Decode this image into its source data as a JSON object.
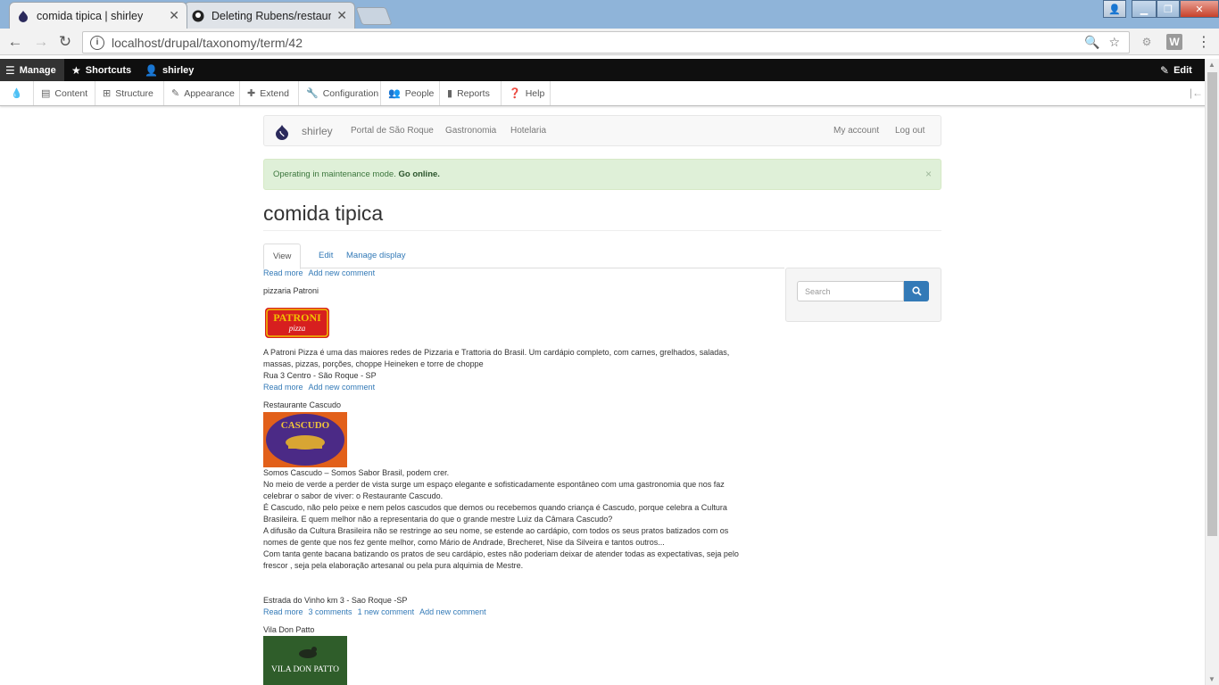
{
  "browser": {
    "tabs": [
      {
        "title": "comida tipica | shirley",
        "icon": "drupal-icon",
        "active": true
      },
      {
        "title": "Deleting Rubens/restaurante",
        "icon": "github-icon",
        "active": false
      }
    ],
    "url": "localhost/drupal/taxonomy/term/42",
    "ext_w": "W"
  },
  "admin_toolbar": {
    "manage": "Manage",
    "shortcuts": "Shortcuts",
    "user": "shirley",
    "edit": "Edit",
    "tray": [
      "Content",
      "Structure",
      "Appearance",
      "Extend",
      "Configuration",
      "People",
      "Reports",
      "Help"
    ]
  },
  "site_nav": {
    "brand": "shirley",
    "links": [
      "Portal de São Roque",
      "Gastronomia",
      "Hotelaria"
    ],
    "account": "My account",
    "logout": "Log out"
  },
  "alert": {
    "message": "Operating in maintenance mode.",
    "link": "Go online.",
    "close": "×"
  },
  "page": {
    "title": "comida tipica",
    "tabs": [
      "View",
      "Edit",
      "Manage display"
    ]
  },
  "search": {
    "placeholder": "Search"
  },
  "content": {
    "top_links": [
      "Read more",
      "Add new comment"
    ],
    "items": [
      {
        "title": "pizzaria Patroni",
        "logo_text": "PATRONI",
        "logo_sub": "pizza",
        "body": [
          "A Patroni Pizza é uma das maiores redes de Pizzaria e Trattoria do Brasil. Um cardápio completo, com carnes, grelhados, saladas,",
          "massas, pizzas, porções, choppe Heineken e torre de choppe",
          "Rua 3 Centro - São Roque - SP"
        ],
        "links": [
          "Read more",
          "Add new comment"
        ]
      },
      {
        "title": "Restaurante Cascudo",
        "logo_text": "CASCUDO",
        "body": [
          "Somos Cascudo – Somos Sabor Brasil, podem crer.",
          "No meio de verde a perder de vista surge um espaço elegante e sofisticadamente espontâneo com uma gastronomia que nos faz",
          "celebrar o sabor de viver: o Restaurante Cascudo.",
          "É Cascudo, não pelo peixe e nem pelos cascudos que demos ou recebemos quando criança é Cascudo, porque celebra a Cultura",
          "Brasileira. E quem melhor não a representaria do que o grande mestre Luiz da Câmara Cascudo?",
          "A difusão da Cultura Brasileira não se restringe ao seu nome, se estende ao cardápio, com todos os seus pratos batizados com os",
          "nomes de gente que nos fez gente melhor, como Mário de Andrade, Brecheret, Nise da Silveira e tantos outros...",
          "Com tanta gente bacana batizando os pratos de seu cardápio, estes não poderiam deixar de atender todas as expectativas, seja pelo",
          "frescor , seja pela elaboração artesanal ou pela pura alquimia de Mestre.",
          "",
          "",
          "Estrada do Vinho km 3 - Sao Roque -SP"
        ],
        "links": [
          "Read more",
          "3 comments",
          "1 new comment",
          "Add new comment"
        ]
      },
      {
        "title": "Vila Don Patto",
        "logo_text": "VILA DON PATTO"
      }
    ]
  }
}
